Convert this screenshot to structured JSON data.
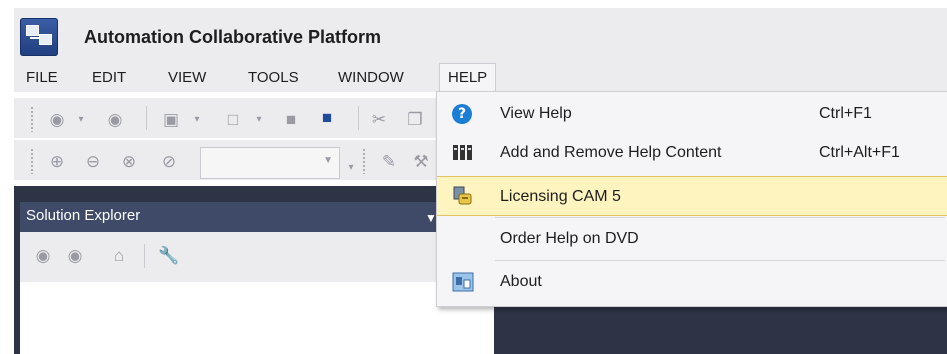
{
  "app": {
    "title": "Automation Collaborative Platform",
    "accent_color": "#1b7ed6",
    "dark_background": "#2d3446"
  },
  "menubar": {
    "items": [
      {
        "label": "FILE"
      },
      {
        "label": "EDIT"
      },
      {
        "label": "VIEW"
      },
      {
        "label": "TOOLS"
      },
      {
        "label": "WINDOW"
      },
      {
        "label": "HELP",
        "active": true
      }
    ]
  },
  "toolbar1": {
    "icons": [
      "back-icon",
      "forward-icon",
      "new-project-icon",
      "add-item-icon",
      "save-icon",
      "save-all-icon",
      "cut-icon",
      "copy-icon"
    ]
  },
  "toolbar2": {
    "icons": [
      "zoom-in-icon",
      "zoom-out-icon",
      "zoom-fit-icon",
      "zoom-icon",
      "pencil-icon"
    ],
    "combo_value": ""
  },
  "solution_explorer": {
    "title": "Solution Explorer",
    "toolbar_icons": [
      "back-icon",
      "forward-icon",
      "home-icon",
      "wrench-icon"
    ]
  },
  "help_menu": {
    "items": [
      {
        "label": "View Help",
        "shortcut": "Ctrl+F1",
        "icon": "help-icon"
      },
      {
        "label": "Add and Remove Help Content",
        "shortcut": "Ctrl+Alt+F1",
        "icon": "books-icon"
      },
      {
        "label": "Licensing CAM 5",
        "shortcut": "",
        "icon": "license-icon",
        "highlighted": true
      },
      {
        "label": "Order Help on DVD",
        "shortcut": "",
        "icon": ""
      },
      {
        "label": "About",
        "shortcut": "",
        "icon": "about-icon"
      }
    ],
    "highlight_color": "#fdf4bf"
  }
}
